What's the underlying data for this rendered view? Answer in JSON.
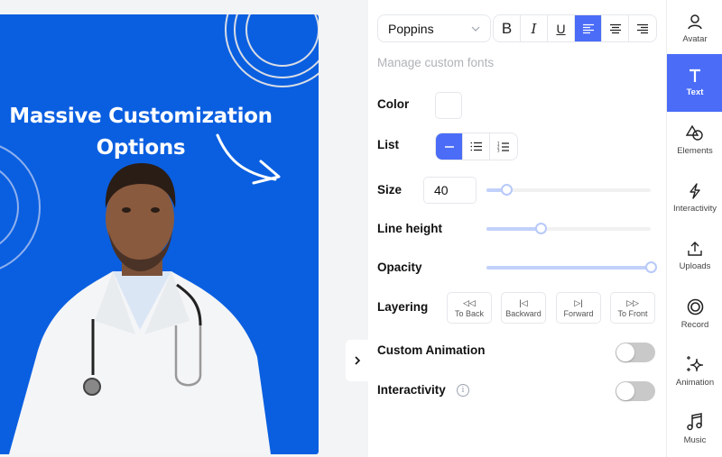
{
  "canvas": {
    "headline_line1": "Massive Customization",
    "headline_line2": "Options",
    "background_color": "#0a5fe0",
    "image_description": "doctor in white coat with stethoscope"
  },
  "panel": {
    "font": {
      "selected": "Poppins"
    },
    "format_buttons": [
      {
        "name": "bold",
        "glyph": "B",
        "active": false
      },
      {
        "name": "italic",
        "glyph": "I",
        "active": false
      },
      {
        "name": "underline",
        "glyph": "U",
        "active": false
      },
      {
        "name": "align-left",
        "active": true
      },
      {
        "name": "align-center",
        "active": false
      },
      {
        "name": "align-right",
        "active": false
      }
    ],
    "manage_fonts_label": "Manage custom fonts",
    "color": {
      "label": "Color",
      "value": "#ffffff"
    },
    "list": {
      "label": "List",
      "options": [
        "none",
        "bullet",
        "numbered"
      ],
      "selected": "none"
    },
    "size": {
      "label": "Size",
      "value": "40",
      "slider_fraction": 0.12
    },
    "line_height": {
      "label": "Line height",
      "slider_fraction": 0.33
    },
    "opacity": {
      "label": "Opacity",
      "slider_fraction": 1.0
    },
    "layering": {
      "label": "Layering",
      "buttons": [
        {
          "label": "To Back",
          "icon": "to-back-icon",
          "glyph": "◁◁"
        },
        {
          "label": "Backward",
          "icon": "backward-icon",
          "glyph": "|◁"
        },
        {
          "label": "Forward",
          "icon": "forward-icon",
          "glyph": "▷|"
        },
        {
          "label": "To Front",
          "icon": "to-front-icon",
          "glyph": "▷▷"
        }
      ]
    },
    "custom_animation": {
      "label": "Custom Animation",
      "enabled": false
    },
    "interactivity": {
      "label": "Interactivity",
      "enabled": false,
      "info_glyph": "i"
    }
  },
  "sidebar": {
    "items": [
      {
        "label": "Avatar",
        "icon": "avatar-icon",
        "active": false
      },
      {
        "label": "Text",
        "icon": "text-icon",
        "active": true
      },
      {
        "label": "Elements",
        "icon": "elements-icon",
        "active": false
      },
      {
        "label": "Interactivity",
        "icon": "interactivity-icon",
        "active": false
      },
      {
        "label": "Uploads",
        "icon": "uploads-icon",
        "active": false
      },
      {
        "label": "Record",
        "icon": "record-icon",
        "active": false
      },
      {
        "label": "Animation",
        "icon": "animation-icon",
        "active": false
      },
      {
        "label": "Music",
        "icon": "music-icon",
        "active": false
      }
    ]
  },
  "colors": {
    "accent": "#4a6cf7",
    "slider_fill": "#c2d1fb",
    "toggle_off": "#c9c9c9"
  }
}
